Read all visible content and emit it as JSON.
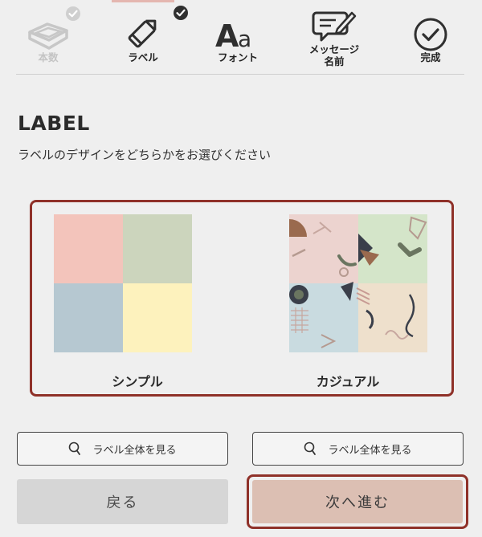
{
  "steps": [
    {
      "label": "本数",
      "icon": "box-icon",
      "state": "done-disabled"
    },
    {
      "label": "ラベル",
      "icon": "pencil-icon",
      "state": "current"
    },
    {
      "label": "フォント",
      "icon": "font-icon",
      "state": "todo"
    },
    {
      "label": "メッセージ\n名前",
      "line1": "メッセージ",
      "line2": "名前",
      "icon": "message-icon",
      "state": "todo"
    },
    {
      "label": "完成",
      "icon": "check-circle-icon",
      "state": "todo"
    }
  ],
  "section": {
    "title": "LABEL",
    "subtitle": "ラベルのデザインをどちらかをお選びください"
  },
  "options": [
    {
      "name": "シンプル",
      "colors": [
        "#f3c4bb",
        "#ccd5bd",
        "#b6c8d1",
        "#fdf2bd"
      ]
    },
    {
      "name": "カジュアル",
      "colors": [
        "#ecd3cf",
        "#d4e5c9",
        "#c9dbe0",
        "#eee0cc"
      ]
    }
  ],
  "view_buttons": [
    {
      "label": "ラベル全体を見る",
      "icon": "search-icon"
    },
    {
      "label": "ラベル全体を見る",
      "icon": "search-icon"
    }
  ],
  "nav": {
    "back_label": "戻る",
    "next_label": "次へ進む"
  },
  "colors": {
    "accent_border": "#8f3129",
    "next_button": "#dcbfb3",
    "back_button": "#d6d6d6"
  }
}
